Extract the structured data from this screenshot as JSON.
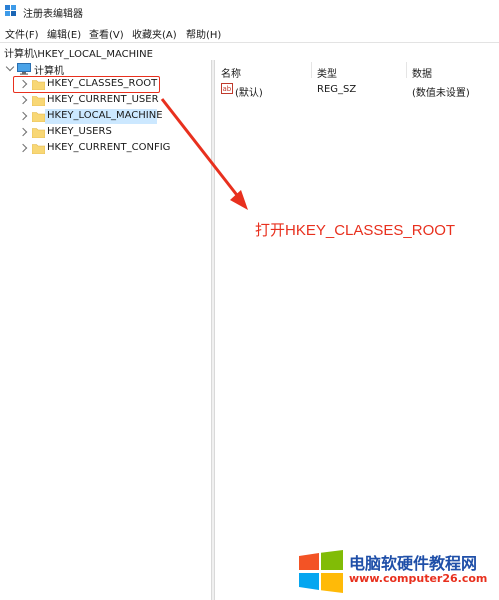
{
  "window": {
    "title": "注册表编辑器"
  },
  "menu": [
    "文件(F)",
    "编辑(E)",
    "查看(V)",
    "收藏夹(A)",
    "帮助(H)"
  ],
  "address": "计算机\\HKEY_LOCAL_MACHINE",
  "tree": {
    "root": "计算机",
    "keys": [
      "HKEY_CLASSES_ROOT",
      "HKEY_CURRENT_USER",
      "HKEY_LOCAL_MACHINE",
      "HKEY_USERS",
      "HKEY_CURRENT_CONFIG"
    ],
    "selected": "HKEY_LOCAL_MACHINE"
  },
  "columns": {
    "name": "名称",
    "type": "类型",
    "data": "数据"
  },
  "values": [
    {
      "name": "(默认)",
      "type": "REG_SZ",
      "data": "(数值未设置)",
      "icon": "string-value-icon"
    }
  ],
  "annotation": "打开HKEY_CLASSES_ROOT",
  "colors": {
    "annotation": "#e8301e",
    "selection": "#cce8ff"
  },
  "watermark": {
    "line1": "电脑软硬件教程网",
    "line2": "www.computer26.com"
  }
}
